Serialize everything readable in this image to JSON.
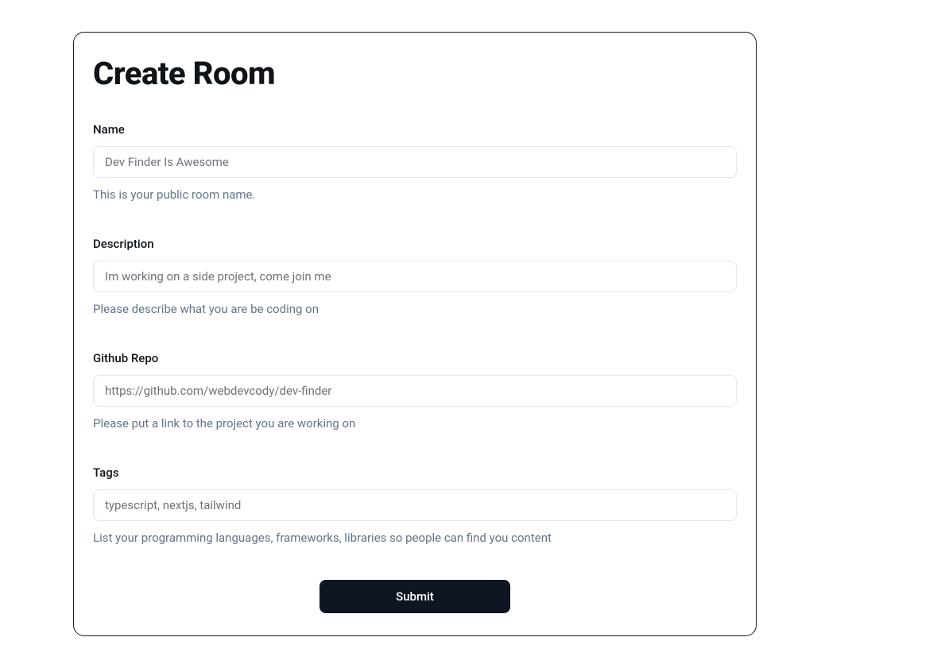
{
  "title": "Create Room",
  "form": {
    "name": {
      "label": "Name",
      "placeholder": "Dev Finder Is Awesome",
      "value": "",
      "help": "This is your public room name."
    },
    "description": {
      "label": "Description",
      "placeholder": "Im working on a side project, come join me",
      "value": "",
      "help": "Please describe what you are be coding on"
    },
    "githubRepo": {
      "label": "Github Repo",
      "placeholder": "https://github.com/webdevcody/dev-finder",
      "value": "",
      "help": "Please put a link to the project you are working on"
    },
    "tags": {
      "label": "Tags",
      "placeholder": "typescript, nextjs, tailwind",
      "value": "",
      "help": "List your programming languages, frameworks, libraries so people can find you content"
    },
    "submit": {
      "label": "Submit"
    }
  }
}
